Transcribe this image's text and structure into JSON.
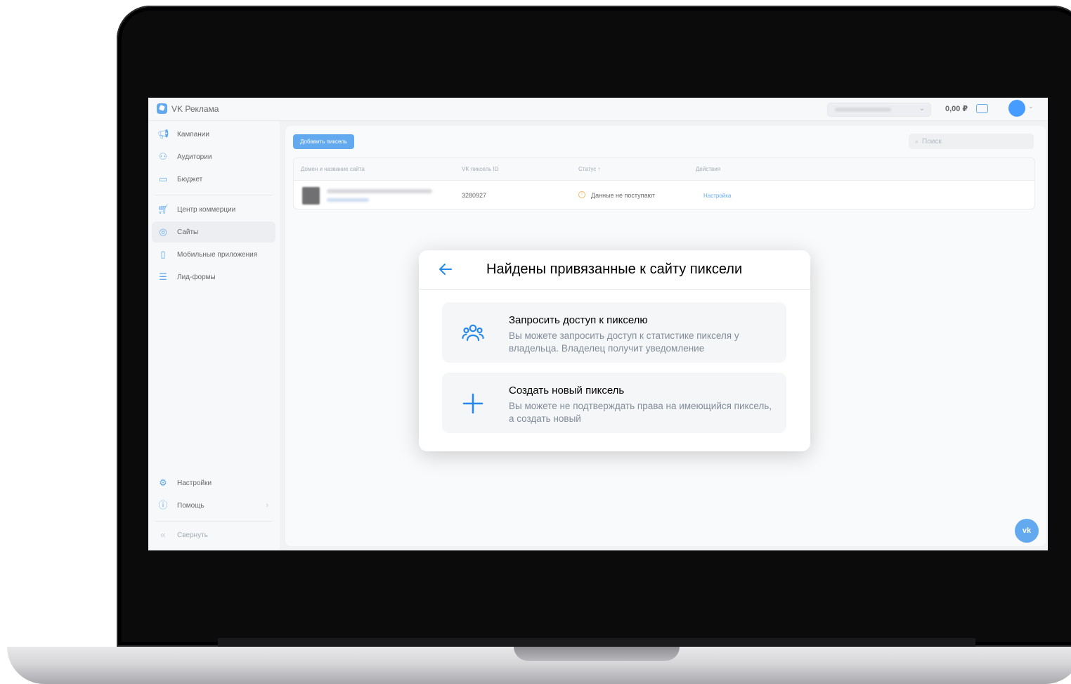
{
  "app": {
    "name": "VK Реклама"
  },
  "topbar": {
    "balance": "0,00 ₽"
  },
  "sidebar": {
    "items": [
      {
        "label": "Кампании",
        "icon": "megaphone-icon"
      },
      {
        "label": "Аудитории",
        "icon": "users-icon"
      },
      {
        "label": "Бюджет",
        "icon": "wallet-icon"
      },
      {
        "label": "Центр коммерции",
        "icon": "cart-icon"
      },
      {
        "label": "Сайты",
        "icon": "globe-icon",
        "active": true
      },
      {
        "label": "Мобильные приложения",
        "icon": "phone-icon"
      },
      {
        "label": "Лид-формы",
        "icon": "form-icon"
      }
    ],
    "bottom": [
      {
        "label": "Настройки",
        "icon": "gear-icon"
      },
      {
        "label": "Помощь",
        "icon": "help-icon"
      },
      {
        "label": "Свернуть",
        "icon": "collapse-icon"
      }
    ]
  },
  "content": {
    "add_button": "Добавить пиксель",
    "search_placeholder": "Поиск",
    "table": {
      "headers": [
        "Домен и название сайта",
        "VK пиксель ID",
        "Статус ↑",
        "Действия"
      ],
      "rows": [
        {
          "pixel_id": "3280927",
          "status": "Данные не поступают",
          "action": "Настройка"
        }
      ]
    }
  },
  "modal": {
    "title": "Найдены привязанные к сайту пиксели",
    "options": [
      {
        "title": "Запросить доступ к пикселю",
        "description": "Вы можете запросить доступ к статистике пикселя у владельца. Владелец получит уведомление",
        "icon": "users-icon"
      },
      {
        "title": "Создать новый пиксель",
        "description": "Вы можете не подтверждать права на имеющийся пиксель, а создать новый",
        "icon": "plus-icon"
      }
    ]
  },
  "colors": {
    "accent": "#2688eb",
    "warning": "#f0a02b"
  }
}
